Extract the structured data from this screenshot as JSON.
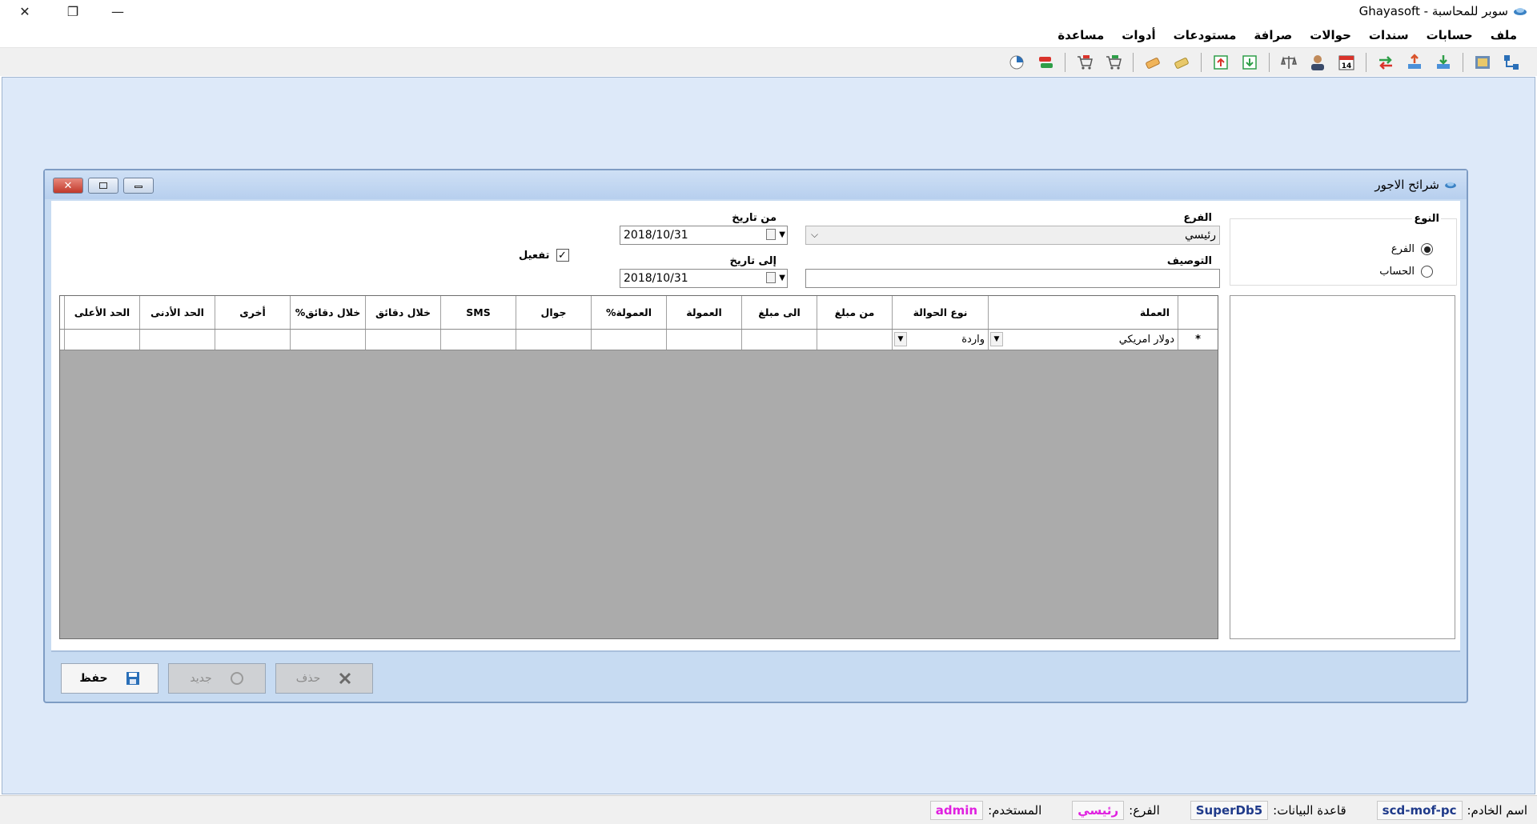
{
  "window": {
    "title": "سوبر للمحاسبة - Ghayasoft",
    "controls": {
      "close": "✕",
      "restore": "❐",
      "minimize": "—"
    }
  },
  "menu": [
    "ملف",
    "حسابات",
    "سندات",
    "حوالات",
    "صرافة",
    "مستودعات",
    "أدوات",
    "مساعدة"
  ],
  "toolbar_icons": [
    "tree-icon",
    "form-icon",
    "import-icon",
    "export-icon",
    "transfer-arrows-icon",
    "calendar-icon",
    "user-icon",
    "scales-icon",
    "download-icon",
    "upload-icon",
    "coins-icon",
    "money-icon",
    "cart-add-icon",
    "cart-remove-icon",
    "flag-icon",
    "pie-chart-icon"
  ],
  "child": {
    "title": "شرائح الاجور",
    "type_group": {
      "label": "النوع",
      "options": [
        "الفرع",
        "الحساب"
      ],
      "selected": "الفرع"
    },
    "branch": {
      "label": "الفرع",
      "value": "رئيسي"
    },
    "description": {
      "label": "التوصيف",
      "value": ""
    },
    "from_date": {
      "label": "من تاريخ",
      "value": "2018/10/31"
    },
    "to_date": {
      "label": "إلى تاريخ",
      "value": "2018/10/31"
    },
    "activate": {
      "label": "تفعيل",
      "checked": true
    },
    "grid": {
      "columns": [
        "العملة",
        "نوع الحوالة",
        "من مبلغ",
        "الى مبلغ",
        "العمولة",
        "العمولة%",
        "جوال",
        "SMS",
        "خلال دقائق",
        "خلال دقائق%",
        "أخرى",
        "الحد الأدنى",
        "الحد الأعلى"
      ],
      "new_row_marker": "*",
      "row": {
        "currency": "دولار امريكي",
        "transfer_type": "واردة"
      }
    },
    "buttons": {
      "save": "حفظ",
      "new": "جديد",
      "delete": "حذف"
    }
  },
  "status": {
    "server_label": "اسم الخادم:",
    "server": "scd-mof-pc",
    "db_label": "قاعدة البيانات:",
    "db": "SuperDb5",
    "branch_label": "الفرع:",
    "branch": "رئيسي",
    "user_label": "المستخدم:",
    "user": "admin",
    "colors": {
      "server": "#1f3a8a",
      "db": "#1f3a8a",
      "branch": "#e020e0",
      "user": "#e020e0"
    }
  }
}
